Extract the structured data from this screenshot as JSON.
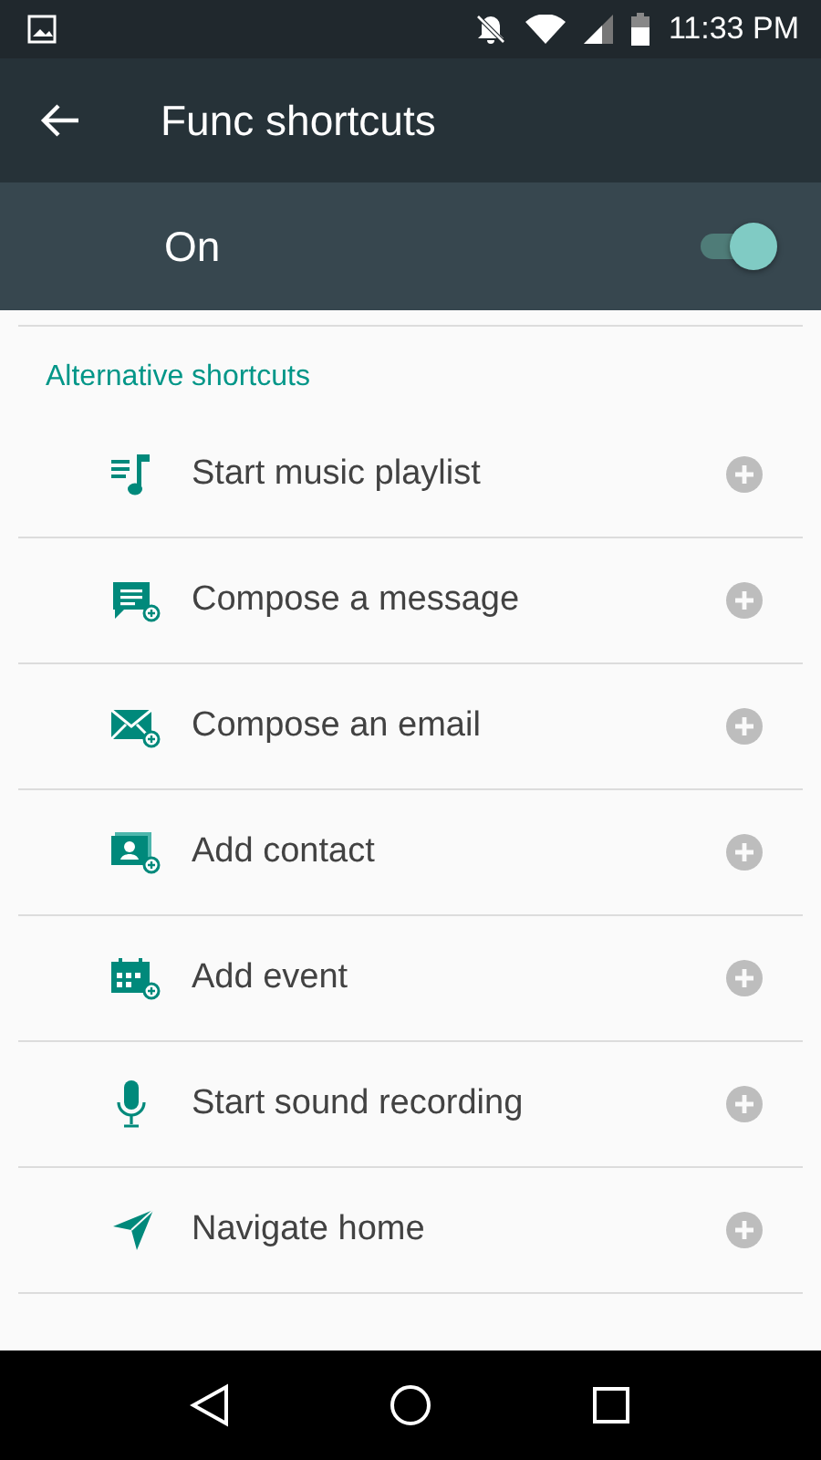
{
  "status_bar": {
    "time": "11:33 PM"
  },
  "app_bar": {
    "title": "Func shortcuts"
  },
  "master_switch": {
    "label": "On",
    "on": true
  },
  "section": {
    "title": "Alternative shortcuts"
  },
  "shortcuts": [
    {
      "label": "Start music playlist"
    },
    {
      "label": "Compose a message"
    },
    {
      "label": "Compose an email"
    },
    {
      "label": "Add contact"
    },
    {
      "label": "Add event"
    },
    {
      "label": "Start sound recording"
    },
    {
      "label": "Navigate home"
    }
  ]
}
